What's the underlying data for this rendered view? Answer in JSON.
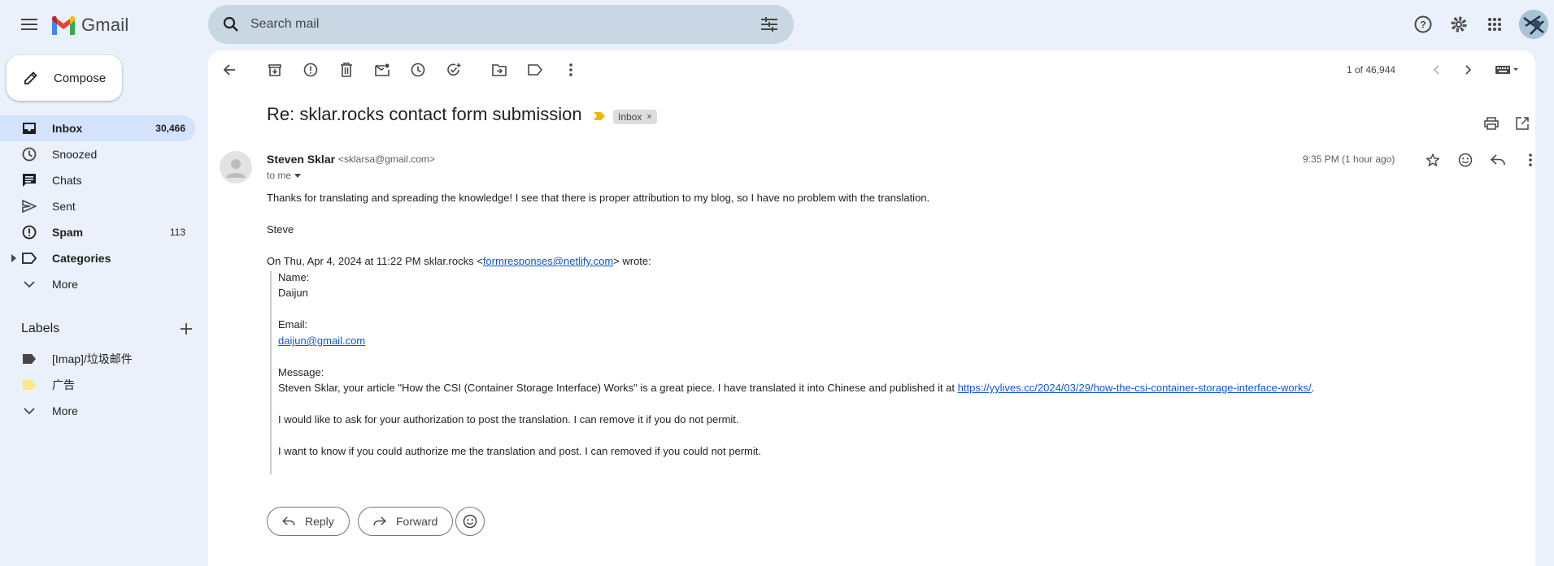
{
  "app": {
    "name": "Gmail"
  },
  "search": {
    "placeholder": "Search mail"
  },
  "sidebar": {
    "compose_label": "Compose",
    "items": [
      {
        "label": "Inbox",
        "count": "30,466"
      },
      {
        "label": "Snoozed",
        "count": ""
      },
      {
        "label": "Chats",
        "count": ""
      },
      {
        "label": "Sent",
        "count": ""
      },
      {
        "label": "Spam",
        "count": "113"
      },
      {
        "label": "Categories",
        "count": ""
      },
      {
        "label": "More",
        "count": ""
      }
    ],
    "labels_title": "Labels",
    "labels": [
      {
        "label": "[Imap]/垃圾邮件",
        "color": "#444746"
      },
      {
        "label": "广告",
        "color": "#fbe983"
      },
      {
        "label": "More",
        "color": ""
      }
    ]
  },
  "toolbar": {
    "page_count": "1 of 46,944"
  },
  "email": {
    "subject": "Re: sklar.rocks contact form submission",
    "label_chip": "Inbox",
    "label_chip_close": "×",
    "sender_name": "Steven Sklar",
    "sender_email": "<sklarsa@gmail.com>",
    "to": "to me",
    "timestamp": "9:35 PM (1 hour ago)",
    "body_line1": "Thanks for translating and spreading the knowledge! I see that there is proper attribution to my blog, so I have no problem with the translation.",
    "signature": "Steve",
    "quote_header_prefix": "On Thu, Apr 4, 2024 at 11:22 PM sklar.rocks <",
    "quote_header_link": "formresponses@netlify.com",
    "quote_header_suffix": "> wrote:",
    "quoted": {
      "name_label": "Name:",
      "name_value": "Daijun",
      "email_label": "Email:",
      "email_value": "daijun@gmail.com",
      "message_label": "Message:",
      "message_text": "Steven Sklar, your article \"How the CSI (Container Storage Interface) Works\" is a great piece. I have translated it into Chinese and published it at ",
      "message_link": "https://yylives.cc/2024/03/29/how-the-csi-container-storage-interface-works/",
      "message_end": ".",
      "line2": "I would like to ask for your authorization to post the translation. I can remove it if you do not permit.",
      "line3": "I want to know if you could authorize me the translation and post. I can removed if you could not permit."
    }
  },
  "actions": {
    "reply_label": "Reply",
    "forward_label": "Forward"
  }
}
